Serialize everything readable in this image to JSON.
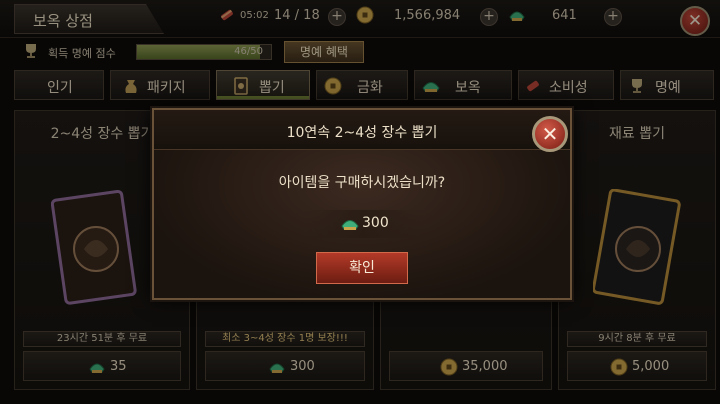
{
  "header": {
    "title": "보옥 상점",
    "stamina": {
      "timer": "05:02",
      "count": "14 / 18"
    },
    "gold": "1,566,984",
    "gems": "641"
  },
  "honor": {
    "label": "획득 명예 점수",
    "progress_text": "46/50",
    "progress": 0.92,
    "button": "명예 혜택"
  },
  "tabs": [
    {
      "label": "인기",
      "icon": "",
      "active": false
    },
    {
      "label": "패키지",
      "icon": "money-bag-icon",
      "active": false
    },
    {
      "label": "뽑기",
      "icon": "card-icon",
      "active": true
    },
    {
      "label": "금화",
      "icon": "coin-icon",
      "active": false
    },
    {
      "label": "보옥",
      "icon": "gem-icon",
      "active": false
    },
    {
      "label": "소비성",
      "icon": "scroll-icon",
      "active": false
    },
    {
      "label": "명예",
      "icon": "trophy-icon",
      "active": false
    }
  ],
  "cards": [
    {
      "title": "2~4성 장수 뽑기",
      "free_text": "23시간 51분 후 무료",
      "price": "35",
      "currency": "gem"
    },
    {
      "title": "",
      "free_text": "최소 3~4성 장수 1명 보장!!!",
      "price": "300",
      "currency": "gem"
    },
    {
      "title": "",
      "free_text": "",
      "price": "35,000",
      "currency": "gold"
    },
    {
      "title": "재료 뽑기",
      "free_text": "9시간 8분 후 무료",
      "price": "5,000",
      "currency": "gold"
    }
  ],
  "modal": {
    "title": "10연속 2~4성 장수 뽑기",
    "message": "아이템을 구매하시겠습니까?",
    "cost": "300",
    "cost_currency": "gem",
    "confirm": "확인"
  },
  "colors": {
    "gem": "#3fae7a",
    "gold": "#c9a34a",
    "confirm": "#a8321f",
    "close": "#b03a2c",
    "progress_fill": "#7a8a42"
  }
}
